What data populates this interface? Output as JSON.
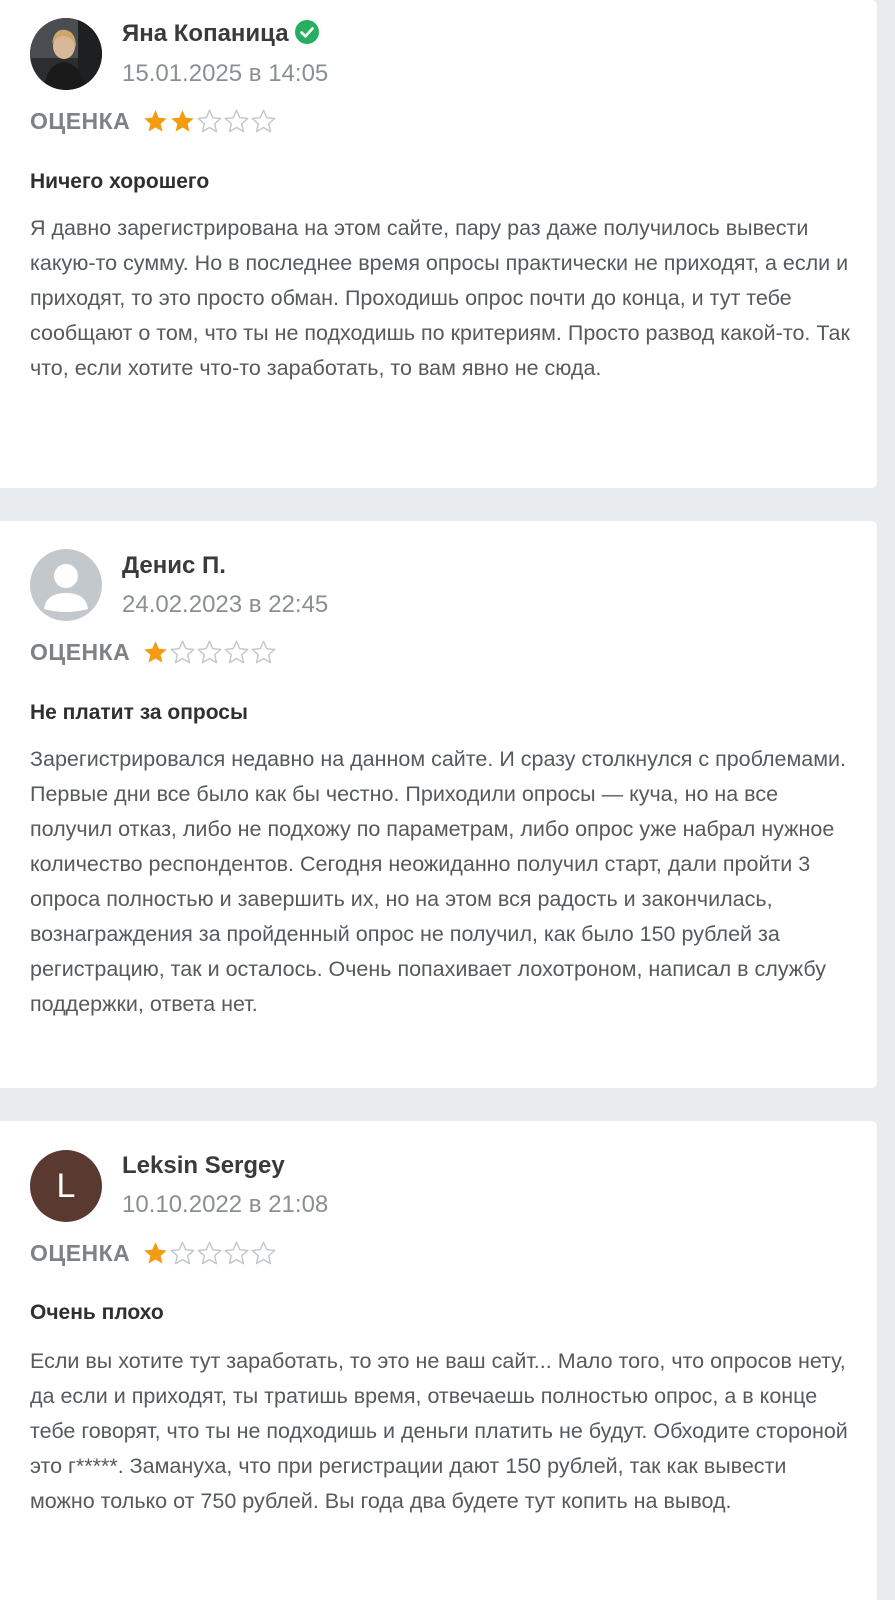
{
  "reviews": [
    {
      "author": "Яна Копаница",
      "verified": true,
      "date": "15.01.2025 в 14:05",
      "rating_label": "ОЦЕНКА",
      "rating": 2,
      "rating_max": 5,
      "title": "Ничего хорошего",
      "text": "Я давно зарегистрирована на этом сайте, пару раз даже получилось вывести какую-то сумму. Но в последнее время опросы практически не приходят, а если и приходят, то это просто обман. Проходишь опрос почти до конца, и тут тебе сообщают о том, что ты не подходишь по критериям. Просто развод какой-то. Так что, если хотите что-то заработать, то вам явно не сюда.",
      "avatar": "photo-avatar"
    },
    {
      "author": "Денис П.",
      "verified": false,
      "date": "24.02.2023 в 22:45",
      "rating_label": "ОЦЕНКА",
      "rating": 1,
      "rating_max": 5,
      "title": "Не платит за опросы",
      "text": "Зарегистрировался недавно на данном сайте. И сразу столкнулся с проблемами. Первые дни все было как бы честно. Приходили опросы — куча, но на все получил отказ, либо не подхожу по параметрам, либо опрос уже набрал нужное количество респондентов. Сегодня неожиданно получил старт, дали пройти 3 опроса полностью и завершить их, но на этом вся радость и закончилась, вознаграждения за пройденный опрос не получил, как было 150 рублей за регистрацию, так и осталось. Очень попахивает лохотроном, написал в службу поддержки, ответа нет.",
      "avatar": "default-user-avatar"
    },
    {
      "author": "Leksin Sergey",
      "verified": false,
      "date": "10.10.2022 в 21:08",
      "rating_label": "ОЦЕНКА",
      "rating": 1,
      "rating_max": 5,
      "title": "Очень плохо",
      "text": "Если вы хотите тут заработать, то это не ваш сайт... Мало того, что опросов нету, да если и приходят, ты тратишь время, отвечаешь полностью опрос, а в конце тебе говорят, что ты не подходишь и деньги платить не будут. Обходите стороной это г*****. Замануха, что при регистрации дают 150 рублей, так как вывести можно только от 750 рублей. Вы года два будете тут копить на вывод.",
      "avatar": "letter-avatar",
      "avatar_letter": "L"
    }
  ],
  "colors": {
    "star_filled": "#f39c12",
    "star_empty": "#c4c8cb",
    "verified": "#27ae60",
    "letter_avatar_bg": "#5a3a30",
    "page_bg": "#e8ecef"
  }
}
